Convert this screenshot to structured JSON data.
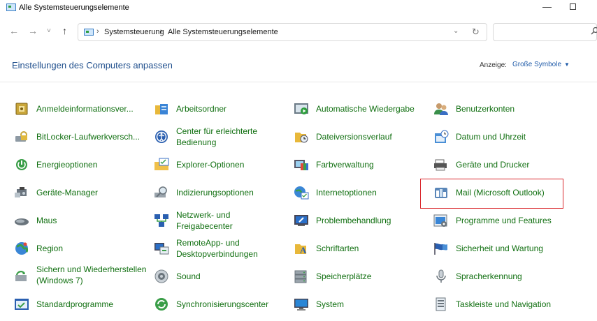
{
  "window": {
    "title": "Alle Systemsteuerungselemente",
    "minimize_glyph": "—"
  },
  "nav": {
    "back": "←",
    "forward": "→",
    "recent": "˅",
    "up": "↑"
  },
  "address": {
    "crumb1": "Systemsteuerung",
    "crumb2": "Alle Systemsteuerungselemente",
    "separator": "›",
    "dropdown_glyph": "⌄",
    "refresh_glyph": "↻",
    "search_placeholder": ""
  },
  "header": {
    "title": "Einstellungen des Computers anpassen",
    "view_label": "Anzeige:",
    "view_value": "Große Symbole",
    "view_caret": "▼"
  },
  "items": [
    {
      "label": "Anmeldeinformationsver...",
      "icon": "credential-manager-icon"
    },
    {
      "label": "Arbeitsordner",
      "icon": "work-folders-icon"
    },
    {
      "label": "Automatische Wiedergabe",
      "icon": "autoplay-icon"
    },
    {
      "label": "Benutzerkonten",
      "icon": "user-accounts-icon"
    },
    {
      "label": "BitLocker-Laufwerkversch...",
      "icon": "bitlocker-icon"
    },
    {
      "label": "Center für erleichterte Bedienung",
      "icon": "ease-of-access-icon"
    },
    {
      "label": "Dateiversionsverlauf",
      "icon": "file-history-icon"
    },
    {
      "label": "Datum und Uhrzeit",
      "icon": "date-time-icon"
    },
    {
      "label": "Energieoptionen",
      "icon": "power-options-icon"
    },
    {
      "label": "Explorer-Optionen",
      "icon": "explorer-options-icon"
    },
    {
      "label": "Farbverwaltung",
      "icon": "color-management-icon"
    },
    {
      "label": "Geräte und Drucker",
      "icon": "devices-printers-icon"
    },
    {
      "label": "Geräte-Manager",
      "icon": "device-manager-icon"
    },
    {
      "label": "Indizierungsoptionen",
      "icon": "indexing-options-icon"
    },
    {
      "label": "Internetoptionen",
      "icon": "internet-options-icon"
    },
    {
      "label": "Mail (Microsoft Outlook)",
      "icon": "mail-icon"
    },
    {
      "label": "Maus",
      "icon": "mouse-icon"
    },
    {
      "label": "Netzwerk- und Freigabecenter",
      "icon": "network-sharing-icon"
    },
    {
      "label": "Problembehandlung",
      "icon": "troubleshooting-icon"
    },
    {
      "label": "Programme und Features",
      "icon": "programs-features-icon"
    },
    {
      "label": "Region",
      "icon": "region-icon"
    },
    {
      "label": "RemoteApp- und Desktopverbindungen",
      "icon": "remoteapp-icon"
    },
    {
      "label": "Schriftarten",
      "icon": "fonts-icon"
    },
    {
      "label": "Sicherheit und Wartung",
      "icon": "security-maintenance-icon"
    },
    {
      "label": "Sichern und Wiederherstellen (Windows 7)",
      "icon": "backup-restore-icon"
    },
    {
      "label": "Sound",
      "icon": "sound-icon"
    },
    {
      "label": "Speicherplätze",
      "icon": "storage-spaces-icon"
    },
    {
      "label": "Spracherkennung",
      "icon": "speech-recognition-icon"
    },
    {
      "label": "Standardprogramme",
      "icon": "default-programs-icon"
    },
    {
      "label": "Synchronisierungscenter",
      "icon": "sync-center-icon"
    },
    {
      "label": "System",
      "icon": "system-icon"
    },
    {
      "label": "Taskleiste und Navigation",
      "icon": "taskbar-navigation-icon"
    }
  ]
}
